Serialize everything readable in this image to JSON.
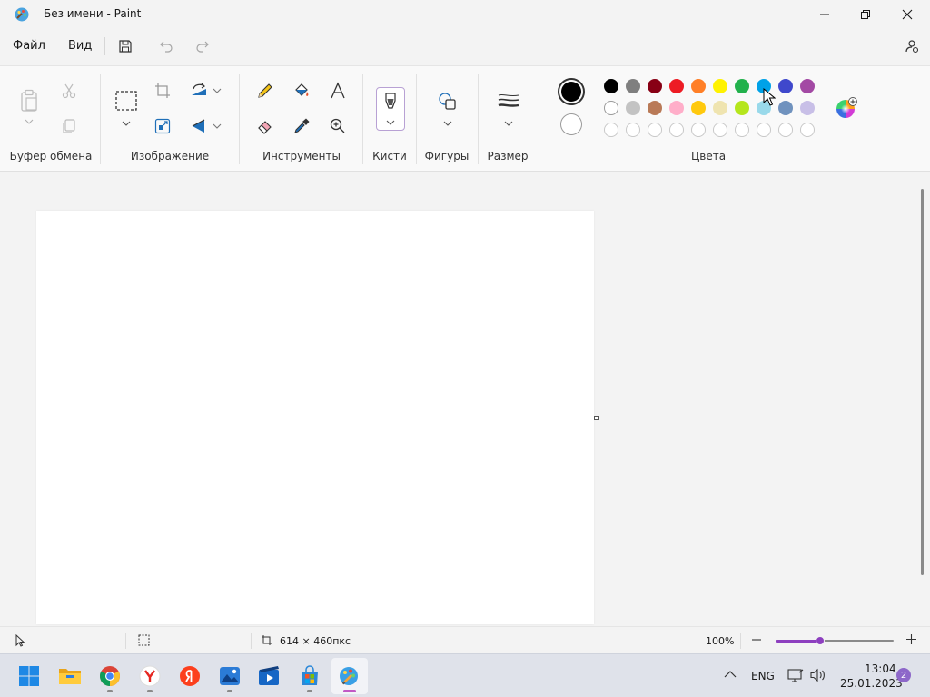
{
  "window": {
    "title": "Без имени - Paint",
    "app_icon": "paint-palette-icon",
    "controls": [
      "minimize-icon",
      "restore-icon",
      "close-icon"
    ]
  },
  "menu": {
    "file": "Файл",
    "view": "Вид",
    "quick_access": [
      "save-icon",
      "undo-icon",
      "redo-icon"
    ],
    "account_icon": "account-settings-icon"
  },
  "ribbon": {
    "groups": {
      "clipboard": "Буфер обмена",
      "image": "Изображение",
      "tools": "Инструменты",
      "brushes": "Кисти",
      "shapes": "Фигуры",
      "size": "Размер",
      "colors": "Цвета"
    },
    "tool_icons": [
      "paste-icon",
      "cut-icon",
      "copy-icon",
      "select-icon",
      "crop-icon",
      "rotate-icon",
      "resize-icon",
      "flip-icon",
      "pencil-icon",
      "fill-icon",
      "text-icon",
      "eraser-icon",
      "color-picker-icon",
      "magnifier-icon",
      "brush-icon",
      "shapes-icon",
      "size-icon",
      "edit-colors-icon"
    ]
  },
  "colors": {
    "color1": "#000000",
    "color2": "#ffffff",
    "palette_row1": [
      "#000000",
      "#7f7f7f",
      "#880015",
      "#ed1c24",
      "#ff7f27",
      "#fff200",
      "#22b14c",
      "#00a2e8",
      "#3f48cc",
      "#a349a4"
    ],
    "palette_row2": [
      "#ffffff",
      "#c3c3c3",
      "#b97a57",
      "#ffaec9",
      "#ffc90e",
      "#efe4b0",
      "#b5e61d",
      "#99d9ea",
      "#7092be",
      "#c8bfe7"
    ],
    "palette_row3_count": 10
  },
  "status": {
    "canvas_size": "614 × 460пкс",
    "zoom": "100%",
    "zoom_level": 0.5
  },
  "taskbar": {
    "apps": [
      "start-icon",
      "file-explorer-icon",
      "chrome-icon",
      "yandex-browser-icon",
      "yandex-icon",
      "photos-icon",
      "movies-tv-icon",
      "microsoft-store-icon",
      "paint-icon"
    ],
    "language": "ENG",
    "time": "13:04",
    "date": "25.01.2023",
    "notifications": "2"
  }
}
